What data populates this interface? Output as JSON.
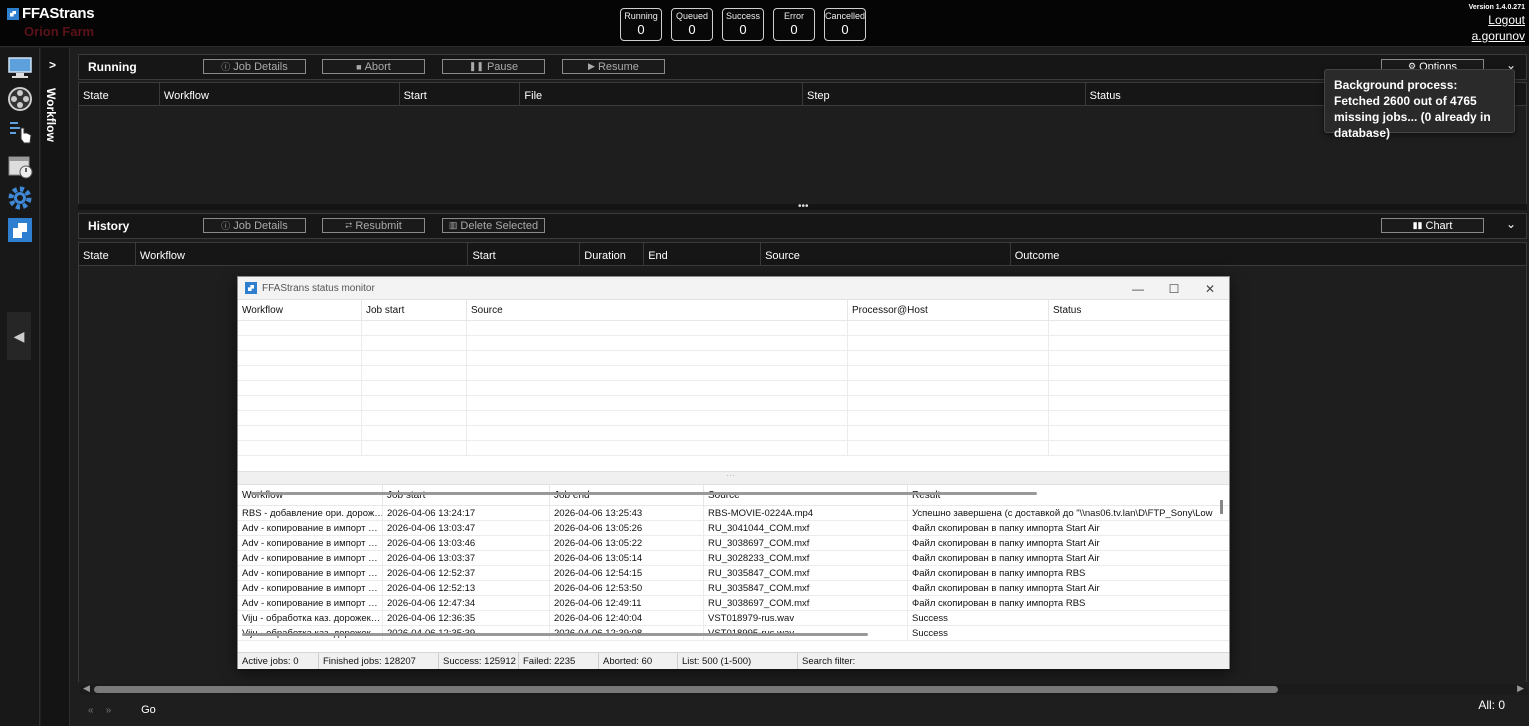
{
  "header": {
    "app_name": "FFAStrans",
    "farm_name": "Orion Farm",
    "version": "Version 1.4.0.271",
    "logout": "Logout",
    "user": "a.gorunov",
    "counters": [
      {
        "label": "Running",
        "value": "0"
      },
      {
        "label": "Queued",
        "value": "0"
      },
      {
        "label": "Success",
        "value": "0"
      },
      {
        "label": "Error",
        "value": "0"
      },
      {
        "label": "Cancelled",
        "value": "0"
      }
    ]
  },
  "sidebar": {
    "icons": [
      "monitor-icon",
      "film-reel-icon",
      "pointer-hand-icon",
      "scheduler-icon",
      "gear-icon",
      "ffastrans-logo-icon"
    ],
    "workflow_label": "Workflow",
    "expand_arrow": ">",
    "collapse_arrow": "◀"
  },
  "running": {
    "title": "Running",
    "buttons": [
      {
        "label": "Job Details",
        "icon": "ⓘ"
      },
      {
        "label": "Abort",
        "icon": "■"
      },
      {
        "label": "Pause",
        "icon": "❚❚"
      },
      {
        "label": "Resume",
        "icon": "▶"
      }
    ],
    "options_label": "Options",
    "columns": [
      "State",
      "Workflow",
      "Start",
      "File",
      "Step",
      "Status"
    ]
  },
  "tooltip": "Background process: Fetched 2600 out of 4765 missing jobs... (0 already in database)",
  "history": {
    "title": "History",
    "buttons": [
      {
        "label": "Job Details",
        "icon": "ⓘ"
      },
      {
        "label": "Resubmit",
        "icon": "⮂"
      },
      {
        "label": "Delete Selected",
        "icon": "🗑"
      }
    ],
    "chart_label": "Chart",
    "columns": [
      "State",
      "Workflow",
      "Start",
      "Duration",
      "End",
      "Source",
      "Outcome"
    ]
  },
  "footer": {
    "go": "Go",
    "all_count": "All: 0"
  },
  "monitor": {
    "title": "FFAStrans status monitor",
    "active_columns": [
      "Workflow",
      "Job start",
      "Source",
      "Processor@Host",
      "Status"
    ],
    "finished_columns": [
      "Workflow",
      "Job start",
      "Job end",
      "Source",
      "Result"
    ],
    "rows": [
      [
        "RBS - добавление ори. дорож…",
        "2026-04-06 13:24:17",
        "2026-04-06 13:25:43",
        "RBS-MOVIE-0224A.mp4",
        "Успешно завершена (с доставкой до \"\\\\nas06.tv.lan\\D\\FTP_Sony\\Low"
      ],
      [
        "Adv - копирование в импорт …",
        "2026-04-06 13:03:47",
        "2026-04-06 13:05:26",
        "RU_3041044_COM.mxf",
        "Файл скопирован в папку импорта Start Air"
      ],
      [
        "Adv - копирование в импорт …",
        "2026-04-06 13:03:46",
        "2026-04-06 13:05:22",
        "RU_3038697_COM.mxf",
        "Файл скопирован в папку импорта Start Air"
      ],
      [
        "Adv - копирование в импорт …",
        "2026-04-06 13:03:37",
        "2026-04-06 13:05:14",
        "RU_3028233_COM.mxf",
        "Файл скопирован в папку импорта Start Air"
      ],
      [
        "Adv - копирование в импорт …",
        "2026-04-06 12:52:37",
        "2026-04-06 12:54:15",
        "RU_3035847_COM.mxf",
        "Файл скопирован в папку импорта RBS"
      ],
      [
        "Adv - копирование в импорт …",
        "2026-04-06 12:52:13",
        "2026-04-06 12:53:50",
        "RU_3035847_COM.mxf",
        "Файл скопирован в папку импорта Start Air"
      ],
      [
        "Adv - копирование в импорт …",
        "2026-04-06 12:47:34",
        "2026-04-06 12:49:11",
        "RU_3038697_COM.mxf",
        "Файл скопирован в папку импорта RBS"
      ],
      [
        "Viju - обработка каз. дорожек…",
        "2026-04-06 12:36:35",
        "2026-04-06 12:40:04",
        "VST018979-rus.wav",
        "Success"
      ],
      [
        "Viju - обработка каз. дорожек…",
        "2026-04-06 12:35:39",
        "2026-04-06 12:39:08",
        "VST018995-rus.wav",
        "Success"
      ]
    ],
    "status": {
      "active": "Active jobs: 0",
      "finished": "Finished jobs: 128207",
      "success": "Success: 125912",
      "failed": "Failed: 2235",
      "aborted": "Aborted: 60",
      "list": "List: 500 (1-500)",
      "search": "Search filter:"
    }
  }
}
